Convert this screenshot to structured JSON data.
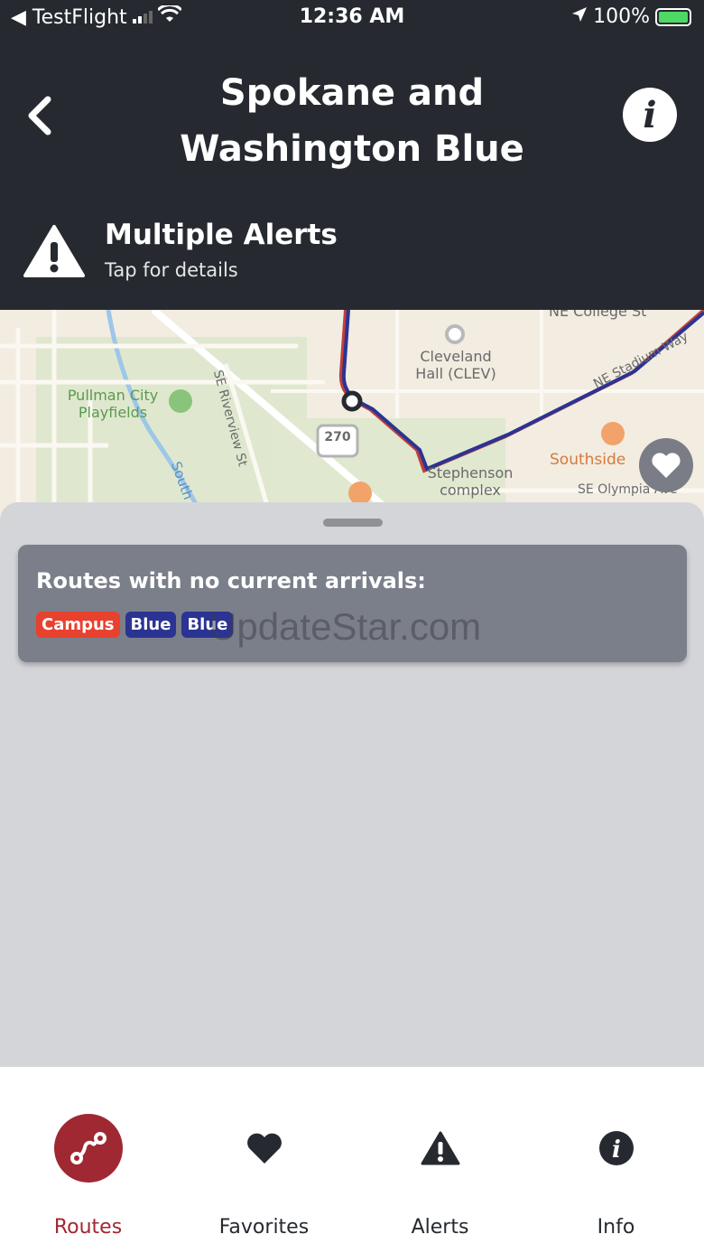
{
  "status_bar": {
    "back_app": "◀ TestFlight",
    "time": "12:36 AM",
    "battery": "100%"
  },
  "header": {
    "title": "Spokane and Washington Blue",
    "alert_title": "Multiple Alerts",
    "alert_subtitle": "Tap for details"
  },
  "map": {
    "labels": {
      "college": "NE College St",
      "cleveland": "Cleveland Hall (CLEV)",
      "pullman": "Pullman City Playfields",
      "riverview": "SE Riverview St",
      "south": "South",
      "stadium": "NE Stadium Way",
      "southside": "Southside",
      "stephenson": "Stephenson complex",
      "olympia": "SE Olympia Ave",
      "route_shield": "270"
    }
  },
  "card": {
    "title": "Routes with no current arrivals:",
    "chips": [
      "Campus",
      "Blue",
      "Blue"
    ]
  },
  "watermark": "UpdateStar.com",
  "tabs": [
    {
      "label": "Routes",
      "icon": "route-icon",
      "active": true
    },
    {
      "label": "Favorites",
      "icon": "heart-icon",
      "active": false
    },
    {
      "label": "Alerts",
      "icon": "warning-icon",
      "active": false
    },
    {
      "label": "Info",
      "icon": "info-icon",
      "active": false
    }
  ],
  "colors": {
    "header_bg": "#262a30",
    "accent": "#a02832",
    "chip_red": "#e8412e",
    "chip_blue": "#2b3492"
  }
}
